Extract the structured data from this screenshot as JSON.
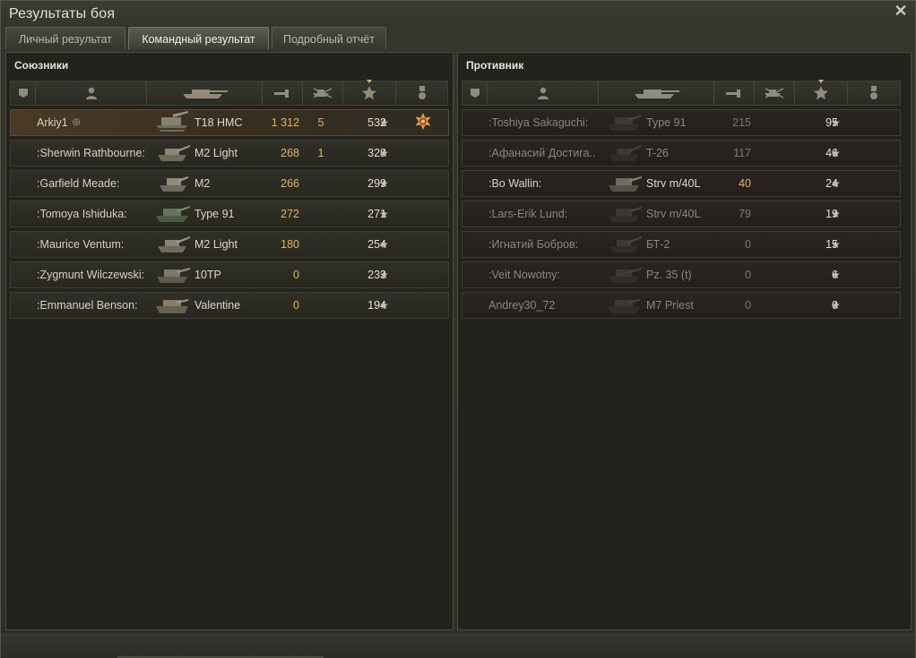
{
  "window": {
    "title": "Результаты боя"
  },
  "tabs": [
    {
      "label": "Личный результат"
    },
    {
      "label": "Командный результат"
    },
    {
      "label": "Подробный отчёт"
    }
  ],
  "allies": {
    "title": "Союзники",
    "rows": [
      {
        "name": "Arkiy1",
        "tank": "T18 HMC",
        "damage": "1 312",
        "kills": "5",
        "xp": "532",
        "medal": true
      },
      {
        "name": ":Sherwin Rathbourne:",
        "tank": "M2 Light",
        "damage": "268",
        "kills": "1",
        "xp": "328"
      },
      {
        "name": ":Garfield Meade:",
        "tank": "M2",
        "damage": "266",
        "kills": "",
        "xp": "299"
      },
      {
        "name": ":Tomoya Ishiduka:",
        "tank": "Type 91",
        "damage": "272",
        "kills": "",
        "xp": "271"
      },
      {
        "name": ":Maurice Ventum:",
        "tank": "M2 Light",
        "damage": "180",
        "kills": "",
        "xp": "254"
      },
      {
        "name": ":Zygmunt Wilczewski:",
        "tank": "10TP",
        "damage": "0",
        "kills": "",
        "xp": "233"
      },
      {
        "name": ":Emmanuel Benson:",
        "tank": "Valentine",
        "damage": "0",
        "kills": "",
        "xp": "194"
      }
    ]
  },
  "enemies": {
    "title": "Противник",
    "rows": [
      {
        "name": ":Toshiya Sakaguchi:",
        "tank": "Type 91",
        "damage": "215",
        "kills": "",
        "xp": "95",
        "dead": true
      },
      {
        "name": ":Афанасий Достига..",
        "tank": "T-26",
        "damage": "117",
        "kills": "",
        "xp": "46",
        "dead": true
      },
      {
        "name": ":Bo Wallin:",
        "tank": "Strv m/40L",
        "damage": "40",
        "kills": "",
        "xp": "24",
        "dead": false
      },
      {
        "name": ":Lars-Erik Lund:",
        "tank": "Strv m/40L",
        "damage": "79",
        "kills": "",
        "xp": "19",
        "dead": true
      },
      {
        "name": ":Игнатий Бобров:",
        "tank": "БТ-2",
        "damage": "0",
        "kills": "",
        "xp": "15",
        "dead": true
      },
      {
        "name": ":Veit Nowotny:",
        "tank": "Pz. 35 (t)",
        "damage": "0",
        "kills": "",
        "xp": "6",
        "dead": true
      },
      {
        "name": "Andrey30_72",
        "tank": "M7 Priest",
        "damage": "0",
        "kills": "",
        "xp": "0",
        "dead": true
      }
    ]
  },
  "columns": [
    "platoon-icon",
    "player-icon",
    "tank-icon",
    "damage-icon",
    "kills-icon",
    "xp-icon",
    "medal-icon"
  ],
  "colors": {
    "accent": "#e8b45a",
    "background": "#23231e"
  }
}
